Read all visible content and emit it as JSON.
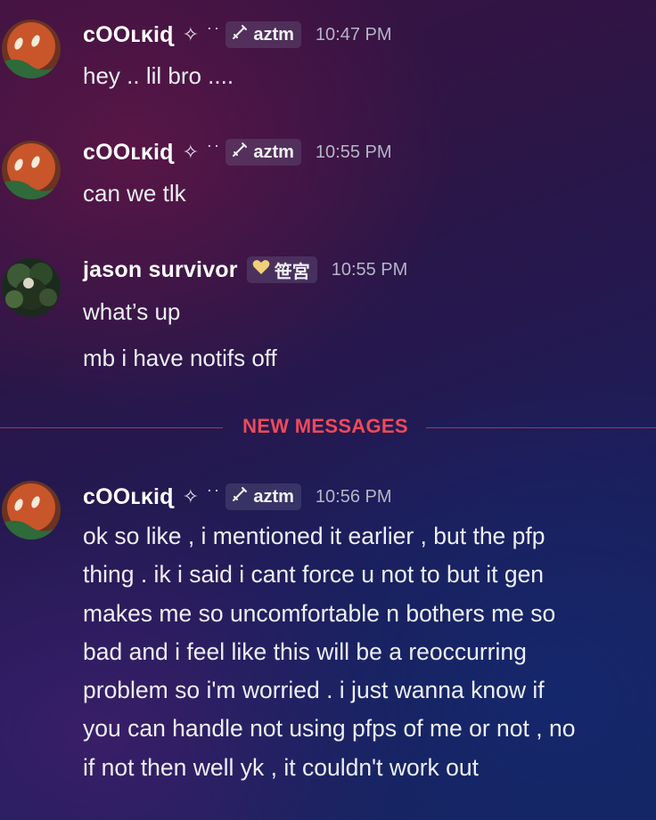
{
  "colors": {
    "new_messages": "#ee4a5a",
    "timestamp": "#b4b6c8",
    "username": "#ffffff",
    "message_text": "#eceef4"
  },
  "messages": [
    {
      "author": "cOOʟᴋiɖ",
      "decoration": "✧ ͘ ͘",
      "tag_icon": "sword-icon",
      "tag": "aztm",
      "time": "10:47 PM",
      "lines": [
        "hey .. lil bro ...."
      ]
    },
    {
      "author": "cOOʟᴋiɖ",
      "decoration": "✧ ͘ ͘",
      "tag_icon": "sword-icon",
      "tag": "aztm",
      "time": "10:55 PM",
      "lines": [
        "can we tlk"
      ]
    },
    {
      "author": "jason survivor",
      "tag_icon": "heart-icon",
      "tag": "笹宮",
      "time": "10:55 PM",
      "lines": [
        "what’s up",
        "mb i have notifs off"
      ]
    },
    {
      "author": "cOOʟᴋiɖ",
      "decoration": "✧ ͘ ͘",
      "tag_icon": "sword-icon",
      "tag": "aztm",
      "time": "10:56 PM",
      "lines": [
        "ok so like , i mentioned it earlier , but the pfp",
        "thing . ik i said i cant force u not to but it gen",
        "makes me so uncomfortable n bothers me so",
        "bad and i feel like this will be a reoccurring",
        "problem so i'm worried . i just wanna know if",
        "you can handle not using pfps of me or not , no",
        "if not then well yk , it couldn't work out"
      ]
    }
  ],
  "divider": {
    "label": "NEW MESSAGES"
  }
}
